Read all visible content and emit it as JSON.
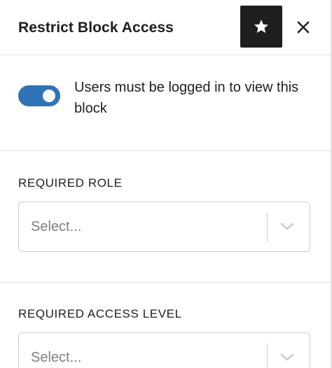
{
  "header": {
    "title": "Restrict Block Access"
  },
  "toggle": {
    "label": "Users must be logged in to view this block",
    "checked": true,
    "color": "#3073b7"
  },
  "role": {
    "label": "REQUIRED ROLE",
    "placeholder": "Select..."
  },
  "access_level": {
    "label": "REQUIRED ACCESS LEVEL",
    "placeholder": "Select..."
  },
  "icons": {
    "star": "star-icon",
    "close": "close-icon",
    "chevron": "chevron-down-icon"
  }
}
